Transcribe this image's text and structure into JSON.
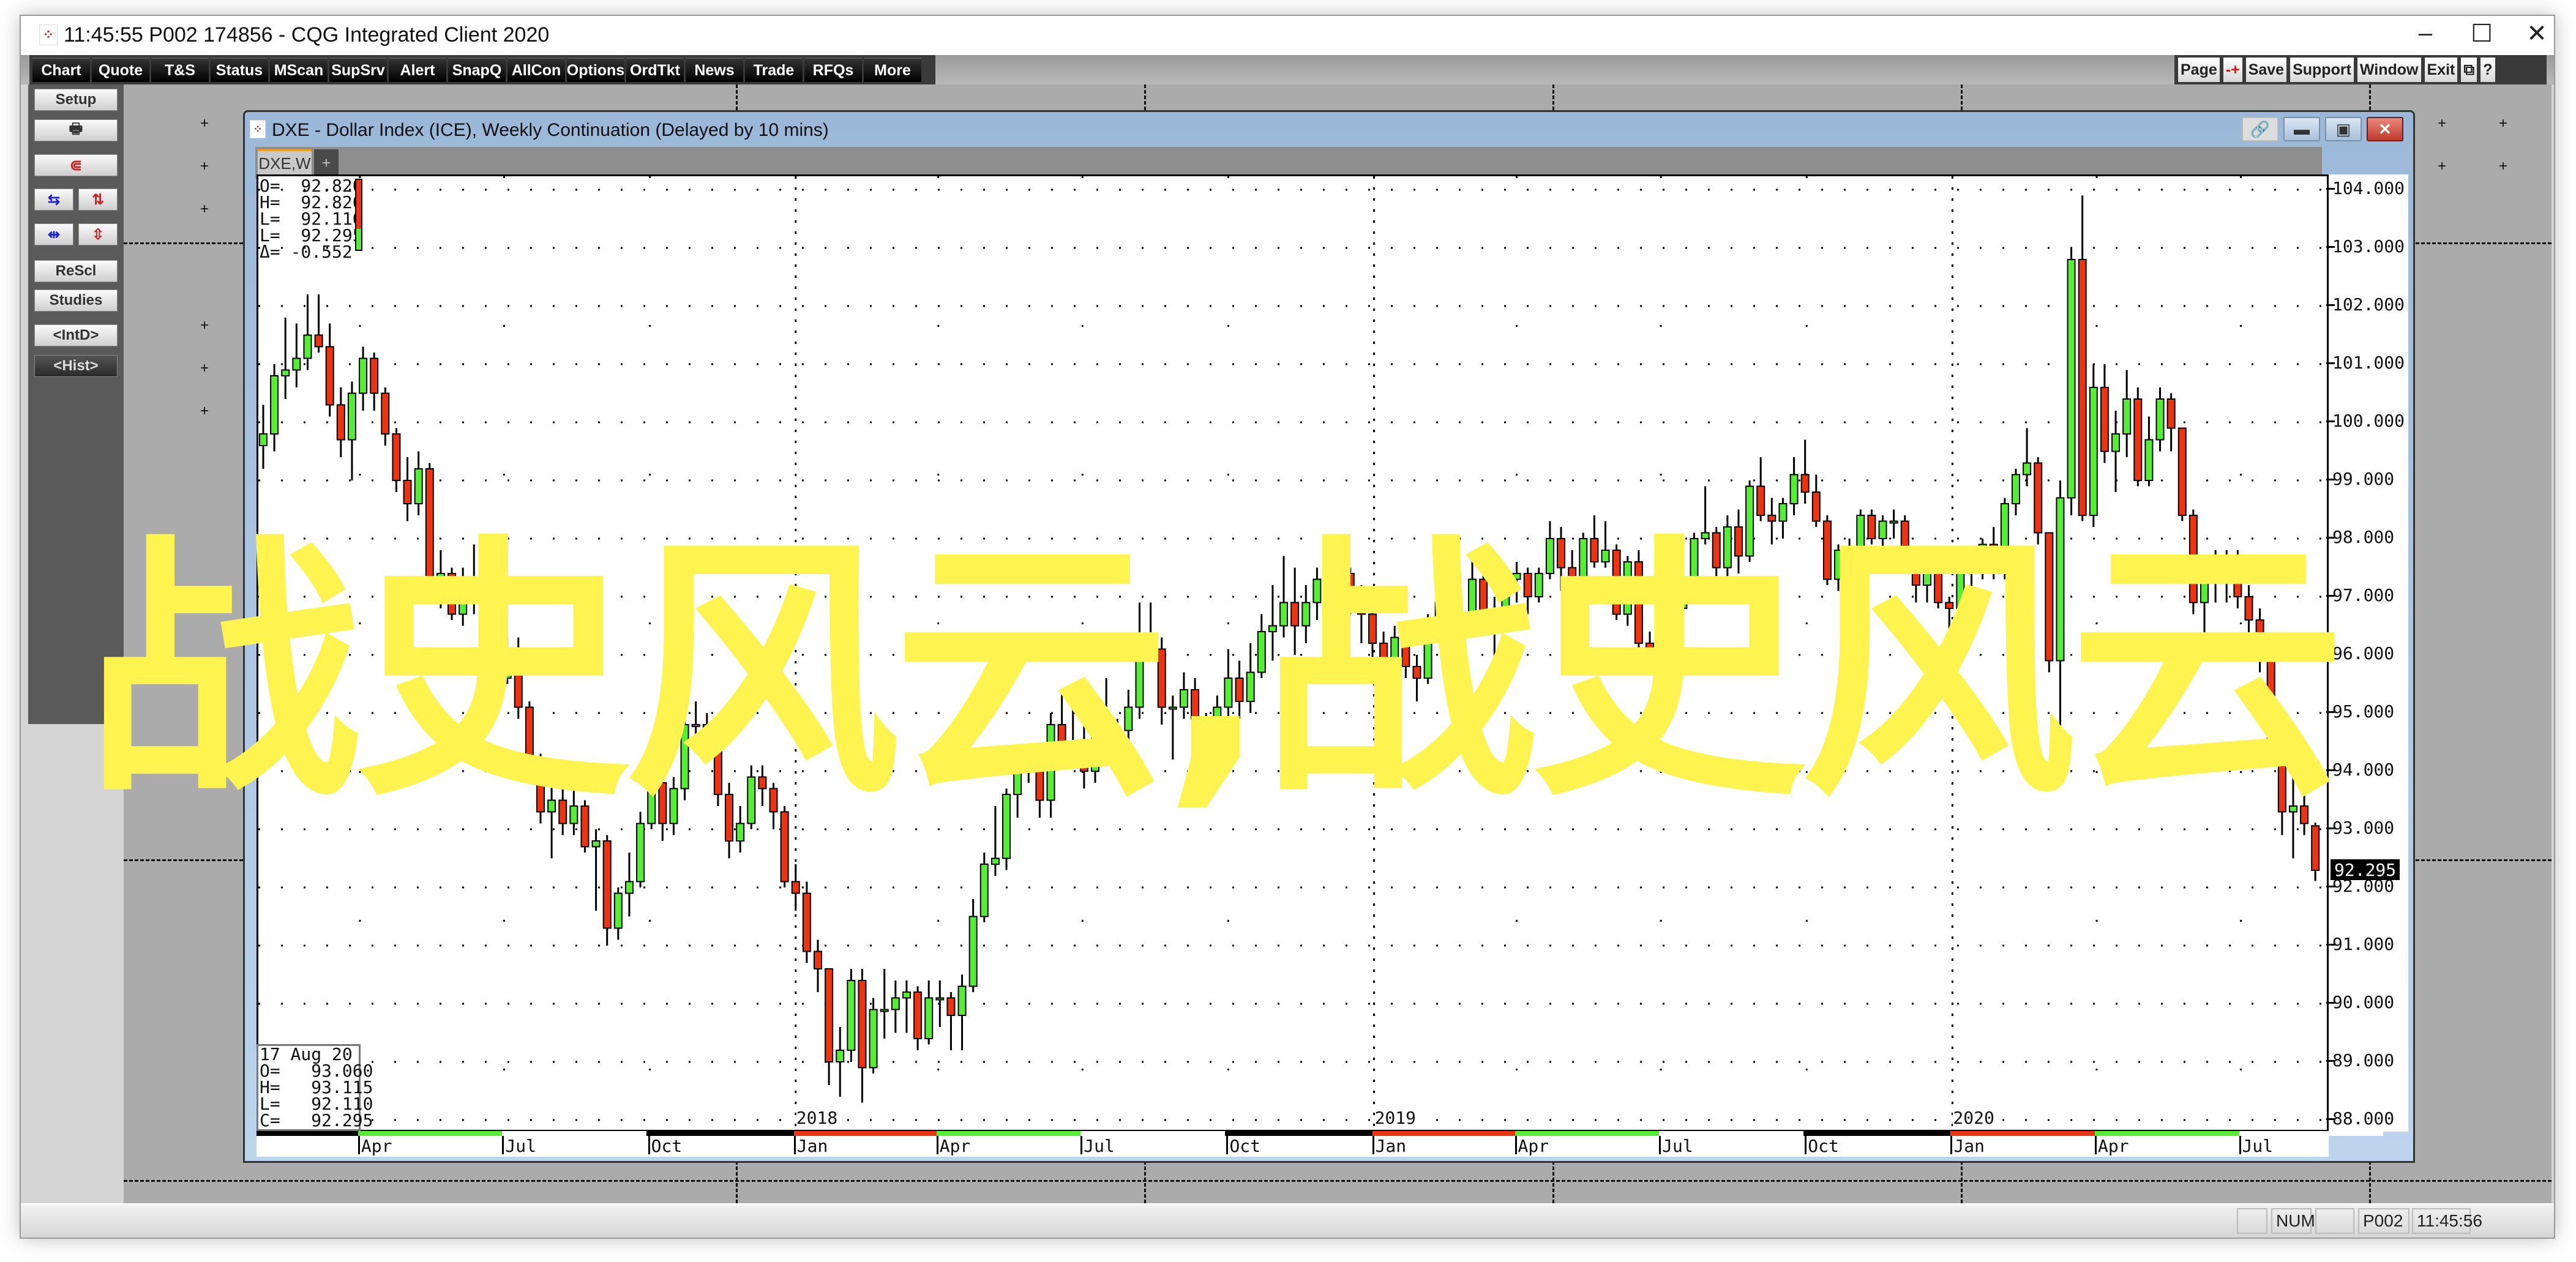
{
  "app": {
    "title": "11:45:55   P002   174856 - CQG Integrated Client 2020",
    "window_controls": [
      "minimize",
      "maximize",
      "close"
    ]
  },
  "toolbar": {
    "left": [
      "Chart",
      "Quote",
      "T&S",
      "Status",
      "MScan",
      "SupSrv",
      "Alert",
      "SnapQ",
      "AllCon",
      "Options",
      "OrdTkt",
      "News",
      "Trade",
      "RFQs",
      "More"
    ],
    "right": [
      "Page",
      "-+",
      "Save",
      "Support",
      "Window",
      "Exit",
      "⧉",
      "?"
    ]
  },
  "left_panel": {
    "setup": "Setup",
    "print_icon": "🖶",
    "magnet_icon": "⋐",
    "rescl": "ReScl",
    "studies": "Studies",
    "intd": "<IntD>",
    "hist": "<Hist>"
  },
  "chart_window": {
    "title": "DXE - Dollar Index (ICE), Weekly Continuation (Delayed by 10 mins)",
    "tab": "DXE,W",
    "add_tab": "+",
    "ohlc_box": {
      "o": "O=  92.820",
      "h": "H=  92.820",
      "l": "L=  92.110",
      "c": "L=  92.295",
      "d": "Δ= -0.552"
    },
    "info_box": {
      "date": "17 Aug 20",
      "o": "O=   93.060",
      "h": "H=   93.115",
      "l": "L=   92.110",
      "c": "C=   92.295"
    },
    "last_price": "92.295"
  },
  "watermark": "战史风云,战史风云",
  "status_bar": {
    "num": "NUM",
    "page": "P002",
    "time": "11:45:56"
  },
  "colors": {
    "up": "#55ee33",
    "down": "#ee3311",
    "watermark": "#fff44f"
  },
  "chart_data": {
    "type": "candlestick",
    "symbol": "DXE",
    "interval": "weekly",
    "first_week": "2017-01-30",
    "last_week": "2020-08-17",
    "ylim": [
      88,
      104
    ],
    "y_ticks": [
      "104.000",
      "103.000",
      "102.000",
      "101.000",
      "100.000",
      "99.000",
      "98.000",
      "97.000",
      "96.000",
      "95.000",
      "94.000",
      "93.000",
      "92.000",
      "91.000",
      "90.000",
      "89.000",
      "88.000"
    ],
    "x_ticks": [
      {
        "label": "Apr",
        "date": "2017-04-01"
      },
      {
        "label": "Jul",
        "date": "2017-07-01"
      },
      {
        "label": "Oct",
        "date": "2017-10-01"
      },
      {
        "label": "Jan",
        "date": "2018-01-01",
        "year": "2018"
      },
      {
        "label": "Apr",
        "date": "2018-04-01"
      },
      {
        "label": "Jul",
        "date": "2018-07-01"
      },
      {
        "label": "Oct",
        "date": "2018-10-01"
      },
      {
        "label": "Jan",
        "date": "2019-01-01",
        "year": "2019"
      },
      {
        "label": "Apr",
        "date": "2019-04-01"
      },
      {
        "label": "Jul",
        "date": "2019-07-01"
      },
      {
        "label": "Oct",
        "date": "2019-10-01"
      },
      {
        "label": "Jan",
        "date": "2020-01-01",
        "year": "2020"
      },
      {
        "label": "Apr",
        "date": "2020-04-01"
      },
      {
        "label": "Jul",
        "date": "2020-07-01"
      }
    ],
    "grid": true,
    "ohlc": [
      [
        99.6,
        100.3,
        99.2,
        99.8
      ],
      [
        99.8,
        101.0,
        99.5,
        100.8
      ],
      [
        100.8,
        101.8,
        100.4,
        100.9
      ],
      [
        100.9,
        101.7,
        100.6,
        101.1
      ],
      [
        101.1,
        102.2,
        100.9,
        101.5
      ],
      [
        101.5,
        102.2,
        101.2,
        101.3
      ],
      [
        101.3,
        101.7,
        100.1,
        100.3
      ],
      [
        100.3,
        100.6,
        99.4,
        99.7
      ],
      [
        99.7,
        100.7,
        99.0,
        100.5
      ],
      [
        100.5,
        101.3,
        100.2,
        101.1
      ],
      [
        101.1,
        101.2,
        100.2,
        100.5
      ],
      [
        100.5,
        100.6,
        99.6,
        99.8
      ],
      [
        99.8,
        99.9,
        98.8,
        99.0
      ],
      [
        99.0,
        99.4,
        98.3,
        98.6
      ],
      [
        98.6,
        99.5,
        98.4,
        99.2
      ],
      [
        99.2,
        99.3,
        96.9,
        97.1
      ],
      [
        97.1,
        97.8,
        96.8,
        97.4
      ],
      [
        97.4,
        97.5,
        96.6,
        96.7
      ],
      [
        96.7,
        97.5,
        96.5,
        97.2
      ],
      [
        97.2,
        97.9,
        96.7,
        97.1
      ],
      [
        97.1,
        97.6,
        96.9,
        97.2
      ],
      [
        97.2,
        97.3,
        95.5,
        95.6
      ],
      [
        95.6,
        96.3,
        95.5,
        96.0
      ],
      [
        96.0,
        96.3,
        94.9,
        95.1
      ],
      [
        95.1,
        95.2,
        93.8,
        93.9
      ],
      [
        93.9,
        94.3,
        93.1,
        93.3
      ],
      [
        93.3,
        93.9,
        92.5,
        93.5
      ],
      [
        93.5,
        93.8,
        92.9,
        93.1
      ],
      [
        93.1,
        93.9,
        92.9,
        93.4
      ],
      [
        93.4,
        93.5,
        92.6,
        92.7
      ],
      [
        92.7,
        93.0,
        91.6,
        92.8
      ],
      [
        92.8,
        92.9,
        91.0,
        91.3
      ],
      [
        91.3,
        92.0,
        91.1,
        91.9
      ],
      [
        91.9,
        92.6,
        91.5,
        92.1
      ],
      [
        92.1,
        93.3,
        92.0,
        93.1
      ],
      [
        93.1,
        94.2,
        93.0,
        93.8
      ],
      [
        93.8,
        93.9,
        92.8,
        93.1
      ],
      [
        93.1,
        93.9,
        92.9,
        93.7
      ],
      [
        93.7,
        95.1,
        93.5,
        94.8
      ],
      [
        94.8,
        95.2,
        94.5,
        94.8
      ],
      [
        94.8,
        95.0,
        94.2,
        94.4
      ],
      [
        94.4,
        94.6,
        93.4,
        93.6
      ],
      [
        93.6,
        93.8,
        92.5,
        92.8
      ],
      [
        92.8,
        93.4,
        92.6,
        93.1
      ],
      [
        93.1,
        94.1,
        93.0,
        93.9
      ],
      [
        93.9,
        94.1,
        93.4,
        93.7
      ],
      [
        93.7,
        93.8,
        93.0,
        93.3
      ],
      [
        93.3,
        93.4,
        92.0,
        92.1
      ],
      [
        92.1,
        92.4,
        91.6,
        91.9
      ],
      [
        91.9,
        92.1,
        90.7,
        90.9
      ],
      [
        90.9,
        91.1,
        90.2,
        90.6
      ],
      [
        90.6,
        90.6,
        88.6,
        89.0
      ],
      [
        89.0,
        89.6,
        88.4,
        89.2
      ],
      [
        89.2,
        90.6,
        89.0,
        90.4
      ],
      [
        90.4,
        90.6,
        88.3,
        88.9
      ],
      [
        88.9,
        90.1,
        88.8,
        89.9
      ],
      [
        89.9,
        90.6,
        89.4,
        89.9
      ],
      [
        89.9,
        90.4,
        89.5,
        90.1
      ],
      [
        90.1,
        90.4,
        89.5,
        90.2
      ],
      [
        90.2,
        90.3,
        89.2,
        89.4
      ],
      [
        89.4,
        90.4,
        89.3,
        90.1
      ],
      [
        90.1,
        90.4,
        89.6,
        90.1
      ],
      [
        90.1,
        90.2,
        89.2,
        89.8
      ],
      [
        89.8,
        90.5,
        89.2,
        90.3
      ],
      [
        90.3,
        91.8,
        90.2,
        91.5
      ],
      [
        91.5,
        92.6,
        91.4,
        92.4
      ],
      [
        92.4,
        93.4,
        92.2,
        92.5
      ],
      [
        92.5,
        93.7,
        92.3,
        93.6
      ],
      [
        93.6,
        94.2,
        93.2,
        94.2
      ],
      [
        94.2,
        94.4,
        93.8,
        94.1
      ],
      [
        94.1,
        94.3,
        93.2,
        93.5
      ],
      [
        93.5,
        95.0,
        93.2,
        94.8
      ],
      [
        94.8,
        95.4,
        94.5,
        94.5
      ],
      [
        94.5,
        95.5,
        94.4,
        94.5
      ],
      [
        94.5,
        94.9,
        93.7,
        94.0
      ],
      [
        94.0,
        95.1,
        93.8,
        94.7
      ],
      [
        94.7,
        95.6,
        94.2,
        94.4
      ],
      [
        94.4,
        94.9,
        94.1,
        94.7
      ],
      [
        94.7,
        95.4,
        94.3,
        95.1
      ],
      [
        95.1,
        96.9,
        94.9,
        96.3
      ],
      [
        96.3,
        96.9,
        95.9,
        96.1
      ],
      [
        96.1,
        96.3,
        94.8,
        95.1
      ],
      [
        95.1,
        95.3,
        94.2,
        95.1
      ],
      [
        95.1,
        95.7,
        94.9,
        95.4
      ],
      [
        95.4,
        95.6,
        94.6,
        94.9
      ],
      [
        94.9,
        95.0,
        93.8,
        94.2
      ],
      [
        94.2,
        95.3,
        93.9,
        95.1
      ],
      [
        95.1,
        96.1,
        94.9,
        95.6
      ],
      [
        95.6,
        95.9,
        94.9,
        95.2
      ],
      [
        95.2,
        96.2,
        95.0,
        95.7
      ],
      [
        95.7,
        96.7,
        95.6,
        96.4
      ],
      [
        96.4,
        97.2,
        95.9,
        96.5
      ],
      [
        96.5,
        97.7,
        96.3,
        96.9
      ],
      [
        96.9,
        97.5,
        96.0,
        96.5
      ],
      [
        96.5,
        97.2,
        96.2,
        96.9
      ],
      [
        96.9,
        97.5,
        96.6,
        97.3
      ],
      [
        97.3,
        97.4,
        96.4,
        96.6
      ],
      [
        96.6,
        97.7,
        96.5,
        97.4
      ],
      [
        97.4,
        97.5,
        96.7,
        96.9
      ],
      [
        96.9,
        97.2,
        96.2,
        96.7
      ],
      [
        96.7,
        96.8,
        95.7,
        96.2
      ],
      [
        96.2,
        96.4,
        95.0,
        95.7
      ],
      [
        95.7,
        96.5,
        95.5,
        96.3
      ],
      [
        96.3,
        96.4,
        95.6,
        95.8
      ],
      [
        95.8,
        96.0,
        95.2,
        95.6
      ],
      [
        95.6,
        96.7,
        95.5,
        96.6
      ],
      [
        96.6,
        97.4,
        96.5,
        96.9
      ],
      [
        96.9,
        97.1,
        96.3,
        96.5
      ],
      [
        96.5,
        96.8,
        95.9,
        96.5
      ],
      [
        96.5,
        97.7,
        96.4,
        97.3
      ],
      [
        97.3,
        97.6,
        96.5,
        96.6
      ],
      [
        96.6,
        97.0,
        95.7,
        96.6
      ],
      [
        96.6,
        97.4,
        96.5,
        97.3
      ],
      [
        97.3,
        97.6,
        96.9,
        97.4
      ],
      [
        97.4,
        97.5,
        96.7,
        97.0
      ],
      [
        97.0,
        97.5,
        96.9,
        97.4
      ],
      [
        97.4,
        98.3,
        97.3,
        98.0
      ],
      [
        98.0,
        98.2,
        97.1,
        97.5
      ],
      [
        97.5,
        97.8,
        97.2,
        97.3
      ],
      [
        97.3,
        98.1,
        97.1,
        98.0
      ],
      [
        98.0,
        98.4,
        97.5,
        97.6
      ],
      [
        97.6,
        98.3,
        97.5,
        97.8
      ],
      [
        97.8,
        97.9,
        96.6,
        96.7
      ],
      [
        96.7,
        97.7,
        96.5,
        97.6
      ],
      [
        97.6,
        97.8,
        96.1,
        96.2
      ],
      [
        96.2,
        96.4,
        95.8,
        96.1
      ],
      [
        96.1,
        97.4,
        96.0,
        97.3
      ],
      [
        97.3,
        97.6,
        96.6,
        96.8
      ],
      [
        96.8,
        97.3,
        96.6,
        97.1
      ],
      [
        97.1,
        98.1,
        97.0,
        98.0
      ],
      [
        98.0,
        98.9,
        97.9,
        98.1
      ],
      [
        98.1,
        98.2,
        97.1,
        97.5
      ],
      [
        97.5,
        98.4,
        97.2,
        98.2
      ],
      [
        98.2,
        98.5,
        97.4,
        97.7
      ],
      [
        97.7,
        99.0,
        97.6,
        98.9
      ],
      [
        98.9,
        99.4,
        98.3,
        98.4
      ],
      [
        98.4,
        98.7,
        97.9,
        98.3
      ],
      [
        98.3,
        98.7,
        98.0,
        98.6
      ],
      [
        98.6,
        99.4,
        98.4,
        99.1
      ],
      [
        99.1,
        99.7,
        98.6,
        98.8
      ],
      [
        98.8,
        99.1,
        98.2,
        98.3
      ],
      [
        98.3,
        98.4,
        97.2,
        97.3
      ],
      [
        97.3,
        97.9,
        97.1,
        97.8
      ],
      [
        97.8,
        98.0,
        97.1,
        97.2
      ],
      [
        97.2,
        98.5,
        97.1,
        98.4
      ],
      [
        98.4,
        98.5,
        97.9,
        98.0
      ],
      [
        98.0,
        98.4,
        97.8,
        98.3
      ],
      [
        98.3,
        98.5,
        98.0,
        98.3
      ],
      [
        98.3,
        98.4,
        97.6,
        97.7
      ],
      [
        97.7,
        97.8,
        96.9,
        97.2
      ],
      [
        97.2,
        97.8,
        96.9,
        97.7
      ],
      [
        97.7,
        97.8,
        96.8,
        96.9
      ],
      [
        96.9,
        97.0,
        96.2,
        96.8
      ],
      [
        96.8,
        97.6,
        96.6,
        97.4
      ],
      [
        97.4,
        97.7,
        97.0,
        97.6
      ],
      [
        97.6,
        98.0,
        97.3,
        97.9
      ],
      [
        97.9,
        98.2,
        97.3,
        97.4
      ],
      [
        97.4,
        98.7,
        97.3,
        98.6
      ],
      [
        98.6,
        99.2,
        98.4,
        99.1
      ],
      [
        99.1,
        99.9,
        98.9,
        99.3
      ],
      [
        99.3,
        99.4,
        97.9,
        98.1
      ],
      [
        98.1,
        98.1,
        95.7,
        95.9
      ],
      [
        95.9,
        99.0,
        94.6,
        98.7
      ],
      [
        98.7,
        103.0,
        98.4,
        102.8
      ],
      [
        102.8,
        103.9,
        98.3,
        98.4
      ],
      [
        98.4,
        101.0,
        98.2,
        100.6
      ],
      [
        100.6,
        101.0,
        99.3,
        99.5
      ],
      [
        99.5,
        100.2,
        98.8,
        99.8
      ],
      [
        99.8,
        100.9,
        99.4,
        100.4
      ],
      [
        100.4,
        100.6,
        98.9,
        99.0
      ],
      [
        99.0,
        100.1,
        98.9,
        99.7
      ],
      [
        99.7,
        100.6,
        99.5,
        100.4
      ],
      [
        100.4,
        100.5,
        99.5,
        99.9
      ],
      [
        99.9,
        99.9,
        98.3,
        98.4
      ],
      [
        98.4,
        98.5,
        96.7,
        96.9
      ],
      [
        96.9,
        97.5,
        96.3,
        97.3
      ],
      [
        97.3,
        97.8,
        96.9,
        97.6
      ],
      [
        97.6,
        97.8,
        96.9,
        97.4
      ],
      [
        97.4,
        97.8,
        96.8,
        97.0
      ],
      [
        97.0,
        97.2,
        96.2,
        96.6
      ],
      [
        96.6,
        96.8,
        95.7,
        96.0
      ],
      [
        96.0,
        96.0,
        94.3,
        94.4
      ],
      [
        94.4,
        94.5,
        92.9,
        93.3
      ],
      [
        93.3,
        93.9,
        92.5,
        93.4
      ],
      [
        93.4,
        93.9,
        92.9,
        93.1
      ],
      [
        93.06,
        93.115,
        92.11,
        92.295
      ]
    ]
  }
}
